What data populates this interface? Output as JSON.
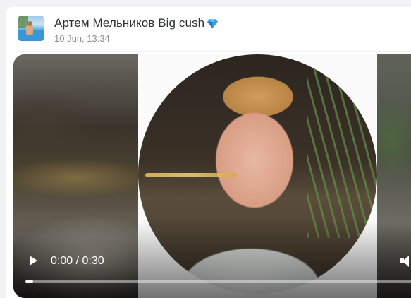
{
  "post": {
    "author_name": "Артем Мельников Big cush",
    "author_badge_icon": "diamond-icon",
    "date": "10 Jun, 13:34"
  },
  "video": {
    "time": "0:00 / 0:30",
    "progress_fraction": 0.02,
    "controls": [
      "play-icon",
      "volume-icon"
    ]
  },
  "colors": {
    "author_text": "#2d2f33",
    "date_text": "#8c9096",
    "badge": "#3aa0e8"
  }
}
